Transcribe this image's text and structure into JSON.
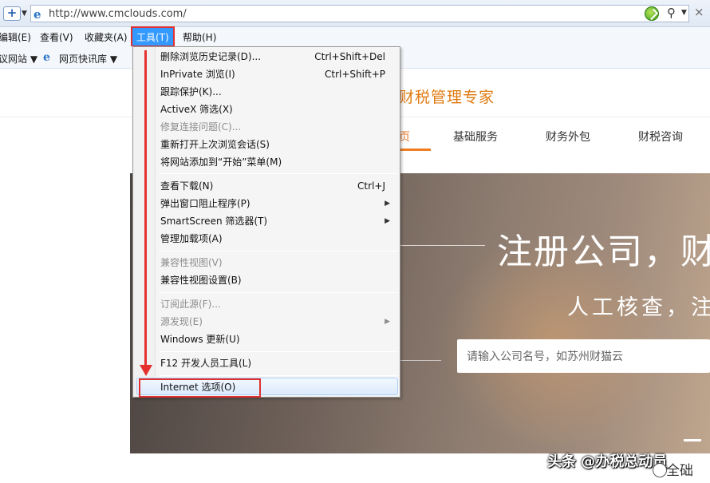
{
  "browser": {
    "url": "http://www.cmclouds.com/",
    "nav_button": "+",
    "ie_logo": "e"
  },
  "menubar": {
    "items": [
      {
        "label": "编辑(E)"
      },
      {
        "label": "查看(V)"
      },
      {
        "label": "收藏夹(A)"
      },
      {
        "label": "工具(T)"
      },
      {
        "label": "帮助(H)"
      }
    ]
  },
  "favorites": {
    "items": [
      {
        "label": "议网站 ▼"
      },
      {
        "label": "网页快讯库 ▼"
      }
    ]
  },
  "tools_menu": {
    "items": [
      {
        "label": "删除浏览历史记录(D)...",
        "shortcut": "Ctrl+Shift+Del"
      },
      {
        "label": "InPrivate 浏览(I)",
        "shortcut": "Ctrl+Shift+P"
      },
      {
        "label": "跟踪保护(K)..."
      },
      {
        "label": "ActiveX 筛选(X)"
      },
      {
        "label": "修复连接问题(C)..."
      },
      {
        "label": "重新打开上次浏览会话(S)"
      },
      {
        "label": "将网站添加到“开始”菜单(M)"
      },
      {
        "label": "查看下载(N)",
        "shortcut": "Ctrl+J"
      },
      {
        "label": "弹出窗口阻止程序(P)"
      },
      {
        "label": "SmartScreen 筛选器(T)"
      },
      {
        "label": "管理加载项(A)"
      },
      {
        "label": "兼容性视图(V)"
      },
      {
        "label": "兼容性视图设置(B)"
      },
      {
        "label": "订阅此源(F)..."
      },
      {
        "label": "源发现(E)"
      },
      {
        "label": "Windows 更新(U)"
      },
      {
        "label": "F12 开发人员工具(L)"
      },
      {
        "label": "Internet 选项(O)"
      }
    ]
  },
  "site": {
    "tagline": "财税管理专家",
    "nav": [
      {
        "label": "页"
      },
      {
        "label": "基础服务"
      },
      {
        "label": "财务外包"
      },
      {
        "label": "财税咨询"
      }
    ],
    "banner_title": "注册公司，财猫",
    "banner_sub": "人工核查，注册",
    "search_placeholder": "请输入公司名号，如苏州财猫云"
  },
  "watermark": {
    "text": "头条 @办税总动员",
    "tail": "全础"
  },
  "colors": {
    "menu_highlight": "#3399ff",
    "annotation_red": "#e03131",
    "brand_orange": "#e07a10"
  }
}
